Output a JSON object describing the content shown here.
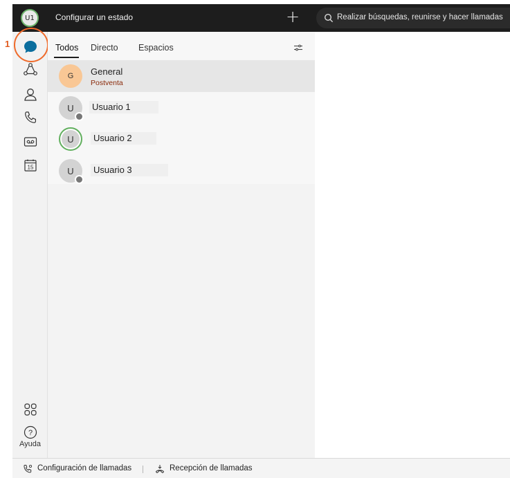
{
  "topbar": {
    "avatar_initials": "U1",
    "status_label": "Configurar un estado",
    "plus_label": "+",
    "search_placeholder": "Realizar búsquedas, reunirse y hacer llamadas"
  },
  "callout": {
    "number": "1"
  },
  "rail": {
    "items": [
      {
        "icon": "chat-icon"
      },
      {
        "icon": "teams-icon"
      },
      {
        "icon": "contacts-icon"
      },
      {
        "icon": "phone-icon"
      },
      {
        "icon": "voicemail-icon"
      },
      {
        "icon": "calendar-icon",
        "text": "15"
      }
    ],
    "apps_icon": "apps-grid-icon",
    "help_icon": "help-icon",
    "help_symbol": "?",
    "help_label": "Ayuda"
  },
  "tabs": {
    "all": "Todos",
    "direct": "Directo",
    "spaces": "Espacios"
  },
  "conversations": [
    {
      "initial": "G",
      "title": "General",
      "subtitle": "Postventa",
      "selected": true
    },
    {
      "initial": "U",
      "title": "Usuario 1",
      "status": "away"
    },
    {
      "initial": "U",
      "title": "Usuario 2",
      "status": "active"
    },
    {
      "initial": "U",
      "title": "Usuario 3",
      "status": "away"
    }
  ],
  "footer": {
    "call_settings": "Configuración de llamadas",
    "call_pickup": "Recepción de llamadas"
  },
  "colors": {
    "accent_blue": "#0b6e9e",
    "callout_orange": "#ef6a2a",
    "active_green": "#62b05f",
    "orange_avatar": "#f9c795"
  }
}
